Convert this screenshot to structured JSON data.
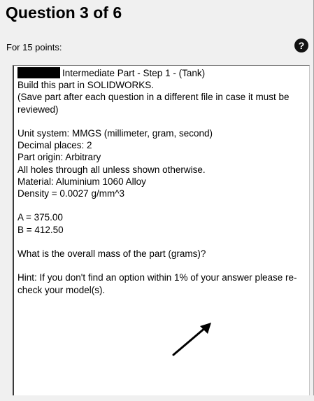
{
  "header": {
    "title": "Question 3 of 6",
    "points_label": "For 15 points:",
    "help_icon": "help-icon",
    "help_glyph": "?"
  },
  "question": {
    "title_text": "Intermediate Part - Step 1 - (Tank)",
    "instruction": "Build this part in SOLIDWORKS.",
    "save_note": "(Save part after each question in a different file in case it must be reviewed)",
    "unit_system": "Unit system: MMGS (millimeter, gram, second)",
    "decimal_places": "Decimal places: 2",
    "part_origin": "Part origin: Arbitrary",
    "holes_note": "All holes through all unless shown otherwise.",
    "material": "Material: Aluminium 1060 Alloy",
    "density": "Density = 0.0027 g/mm^3",
    "param_a": "A = 375.00",
    "param_b": "B = 412.50",
    "prompt": "What is the overall mass of the part (grams)?",
    "hint": "Hint: If you don't find an option within 1% of your answer please re-check your model(s)."
  },
  "colors": {
    "panel_background": "#f0f0f0",
    "text_box_background": "#ffffff",
    "text": "#000000",
    "redaction": "#000000"
  }
}
